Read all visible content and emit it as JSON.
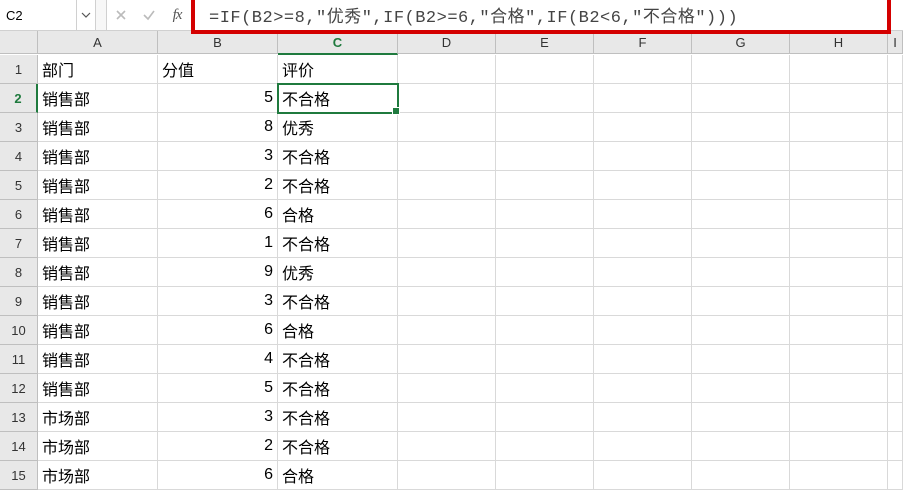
{
  "name_box": {
    "value": "C2"
  },
  "formula_bar": {
    "cancel_tip": "Cancel",
    "enter_tip": "Enter",
    "fx_label": "fx",
    "formula": "=IF(B2>=8,\"优秀\",IF(B2>=6,\"合格\",IF(B2<6,\"不合格\")))"
  },
  "columns": [
    "A",
    "B",
    "C",
    "D",
    "E",
    "F",
    "G",
    "H",
    "I"
  ],
  "active_col_index": 2,
  "active_row_index": 2,
  "selected_cell": {
    "row": 2,
    "col": "C"
  },
  "headers": {
    "A": "部门",
    "B": "分值",
    "C": "评价"
  },
  "rows": [
    {
      "n": 1,
      "A": "部门",
      "B": "分值",
      "B_num": false,
      "C": "评价"
    },
    {
      "n": 2,
      "A": "销售部",
      "B": "5",
      "B_num": true,
      "C": "不合格"
    },
    {
      "n": 3,
      "A": "销售部",
      "B": "8",
      "B_num": true,
      "C": "优秀"
    },
    {
      "n": 4,
      "A": "销售部",
      "B": "3",
      "B_num": true,
      "C": "不合格"
    },
    {
      "n": 5,
      "A": "销售部",
      "B": "2",
      "B_num": true,
      "C": "不合格"
    },
    {
      "n": 6,
      "A": "销售部",
      "B": "6",
      "B_num": true,
      "C": "合格"
    },
    {
      "n": 7,
      "A": "销售部",
      "B": "1",
      "B_num": true,
      "C": "不合格"
    },
    {
      "n": 8,
      "A": "销售部",
      "B": "9",
      "B_num": true,
      "C": "优秀"
    },
    {
      "n": 9,
      "A": "销售部",
      "B": "3",
      "B_num": true,
      "C": "不合格"
    },
    {
      "n": 10,
      "A": "销售部",
      "B": "6",
      "B_num": true,
      "C": "合格"
    },
    {
      "n": 11,
      "A": "销售部",
      "B": "4",
      "B_num": true,
      "C": "不合格"
    },
    {
      "n": 12,
      "A": "销售部",
      "B": "5",
      "B_num": true,
      "C": "不合格"
    },
    {
      "n": 13,
      "A": "市场部",
      "B": "3",
      "B_num": true,
      "C": "不合格"
    },
    {
      "n": 14,
      "A": "市场部",
      "B": "2",
      "B_num": true,
      "C": "不合格"
    },
    {
      "n": 15,
      "A": "市场部",
      "B": "6",
      "B_num": true,
      "C": "合格"
    }
  ]
}
